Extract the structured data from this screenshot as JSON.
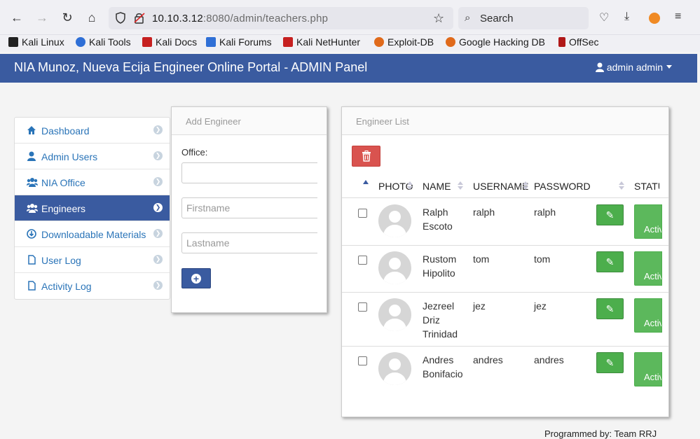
{
  "browser": {
    "url_host": "10.10.3.12",
    "url_rest": ":8080/admin/teachers.php",
    "search_placeholder": "Search"
  },
  "bookmarks": [
    {
      "label": "Kali Linux",
      "color": "#222222"
    },
    {
      "label": "Kali Tools",
      "color": "#2f6fd6"
    },
    {
      "label": "Kali Docs",
      "color": "#c62020"
    },
    {
      "label": "Kali Forums",
      "color": "#2f6fd6"
    },
    {
      "label": "Kali NetHunter",
      "color": "#c62020"
    },
    {
      "label": "Exploit-DB",
      "color": "#e06a1b"
    },
    {
      "label": "Google Hacking DB",
      "color": "#e06a1b"
    },
    {
      "label": "OffSec",
      "color": "#b01818"
    }
  ],
  "header": {
    "title": "NIA Munoz, Nueva Ecija Engineer Online Portal - ADMIN Panel",
    "user": "admin admin",
    "color": "#3a5ba0"
  },
  "sidebar": {
    "items": [
      {
        "label": "Dashboard",
        "icon": "home-icon"
      },
      {
        "label": "Admin Users",
        "icon": "user-icon"
      },
      {
        "label": "NIA Office",
        "icon": "group-icon"
      },
      {
        "label": "Engineers",
        "icon": "group-icon",
        "active": true
      },
      {
        "label": "Downloadable Materials",
        "icon": "download-icon"
      },
      {
        "label": "User Log",
        "icon": "file-icon"
      },
      {
        "label": "Activity Log",
        "icon": "file-icon"
      }
    ]
  },
  "add_panel": {
    "title": "Add Engineer",
    "office_label": "Office:",
    "office_value": "",
    "firstname_placeholder": "Firstname",
    "lastname_placeholder": "Lastname"
  },
  "list_panel": {
    "title": "Engineer List",
    "columns": [
      "PHOTO",
      "NAME",
      "USERNAME",
      "PASSWORD",
      "STATUS"
    ],
    "status_label": "Active",
    "rows": [
      {
        "name_line1": "Ralph",
        "name_line2": "Escoto",
        "name_line3": "",
        "username": "ralph",
        "password": "ralph"
      },
      {
        "name_line1": "Rustom",
        "name_line2": "Hipolito",
        "name_line3": "",
        "username": "tom",
        "password": "tom"
      },
      {
        "name_line1": "Jezreel",
        "name_line2": "Driz",
        "name_line3": "Trinidad",
        "username": "jez",
        "password": "jez"
      },
      {
        "name_line1": "Andres",
        "name_line2": "Bonifacio",
        "name_line3": "",
        "username": "andres",
        "password": "andres"
      }
    ]
  },
  "footer": {
    "credit": "Programmed by: Team RRJ"
  }
}
